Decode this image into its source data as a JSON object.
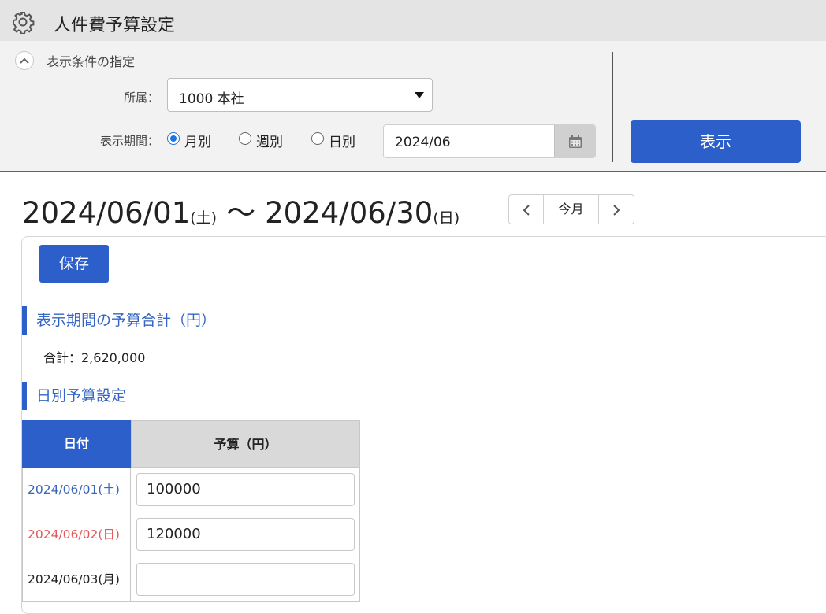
{
  "app": {
    "title": "人件費予算設定"
  },
  "filter": {
    "heading": "表示条件の指定",
    "department_label": "所属：",
    "department_value": "1000 本社",
    "period_label": "表示期間：",
    "period_options": [
      {
        "label": "月別",
        "checked": true
      },
      {
        "label": "週別",
        "checked": false
      },
      {
        "label": "日別",
        "checked": false
      }
    ],
    "date_value": "2024/06",
    "show_button": "表示"
  },
  "range": {
    "start_date": "2024/06/01",
    "start_day": "(土)",
    "tilde": "〜",
    "end_date": "2024/06/30",
    "end_day": "(日)"
  },
  "nav": {
    "today_label": "今月"
  },
  "save_button": "保存",
  "total_section": {
    "heading": "表示期間の予算合計（円）",
    "total_text": "合計：2,620,000"
  },
  "daily_section": {
    "heading": "日別予算設定",
    "columns": [
      "日付",
      "予算（円）"
    ],
    "rows": [
      {
        "date": "2024/06/01(土)",
        "type": "sat",
        "value": "100000"
      },
      {
        "date": "2024/06/02(日)",
        "type": "sun",
        "value": "120000"
      },
      {
        "date": "2024/06/03(月)",
        "type": "wkd",
        "value": ""
      }
    ]
  },
  "colors": {
    "primary": "#2c5fc9",
    "saturday": "#3a66b5",
    "sunday": "#e05a5a",
    "header_bg": "#e4e4e4"
  },
  "icons": [
    "gear-icon",
    "chevron-up-icon",
    "caret-down-icon",
    "calendar-icon",
    "chevron-left-icon",
    "chevron-right-icon"
  ]
}
